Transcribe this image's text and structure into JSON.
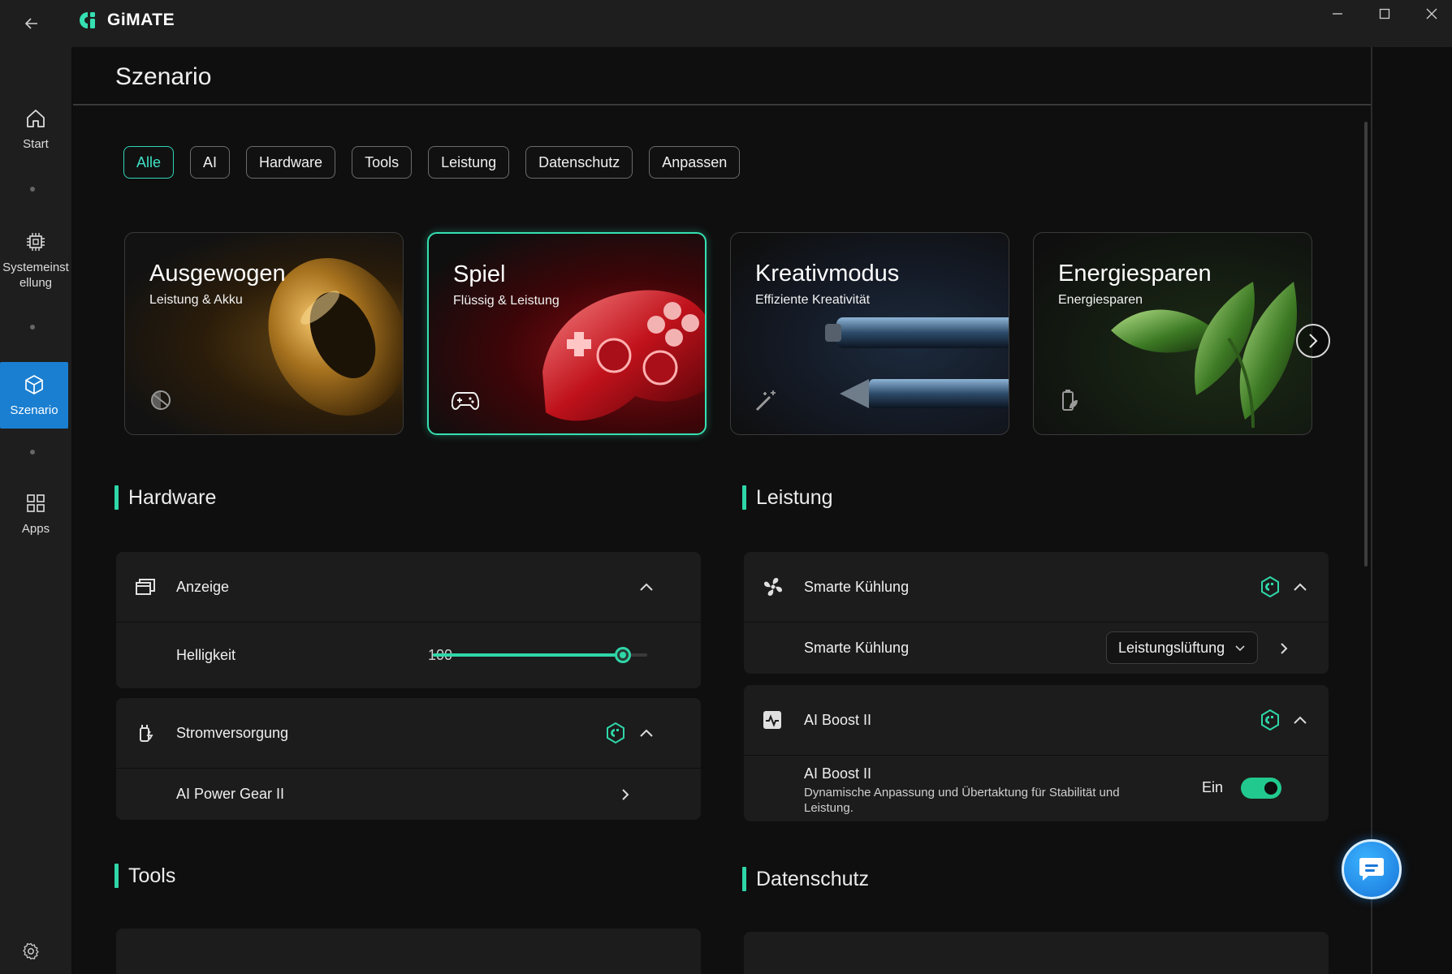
{
  "app": {
    "name": "GiMATE"
  },
  "sidebar": {
    "items": [
      {
        "label": "Start",
        "icon": "home-icon"
      },
      {
        "label": "Systemeinst ellung",
        "icon": "chip-icon"
      },
      {
        "label": "Szenario",
        "icon": "cube-icon",
        "active": true
      },
      {
        "label": "Apps",
        "icon": "grid-icon"
      }
    ]
  },
  "page": {
    "title": "Szenario"
  },
  "filters": [
    "Alle",
    "AI",
    "Hardware",
    "Tools",
    "Leistung",
    "Datenschutz",
    "Anpassen"
  ],
  "active_filter": "Alle",
  "scenarios": [
    {
      "title": "Ausgewogen",
      "subtitle": "Leistung & Akku",
      "icon": "balance-icon"
    },
    {
      "title": "Spiel",
      "subtitle": "Flüssig & Leistung",
      "icon": "gamepad-icon",
      "selected": true
    },
    {
      "title": "Kreativmodus",
      "subtitle": "Effiziente Kreativität",
      "icon": "magic-wand-icon"
    },
    {
      "title": "Energiesparen",
      "subtitle": "Energiesparen",
      "icon": "battery-leaf-icon"
    }
  ],
  "sections": {
    "hardware": {
      "title": "Hardware",
      "display": {
        "label": "Anzeige",
        "brightness_label": "Helligkeit",
        "brightness_value": "100",
        "brightness_fraction": 1.0
      },
      "power": {
        "label": "Stromversorgung",
        "gear_label": "AI Power Gear II"
      }
    },
    "performance": {
      "title": "Leistung",
      "cooling": {
        "label": "Smarte Kühlung",
        "row_label": "Smarte Kühlung",
        "selected": "Leistungslüftung"
      },
      "boost": {
        "label": "AI Boost II",
        "row_title": "AI Boost II",
        "row_desc": "Dynamische Anpassung und Übertaktung für Stabilität und Leistung.",
        "state_label": "Ein",
        "enabled": true
      }
    },
    "tools": {
      "title": "Tools"
    },
    "privacy": {
      "title": "Datenschutz"
    }
  },
  "colors": {
    "accent": "#2fd6a8",
    "active_nav": "#1a7fd1",
    "chip_active": "#2fd6b8"
  }
}
